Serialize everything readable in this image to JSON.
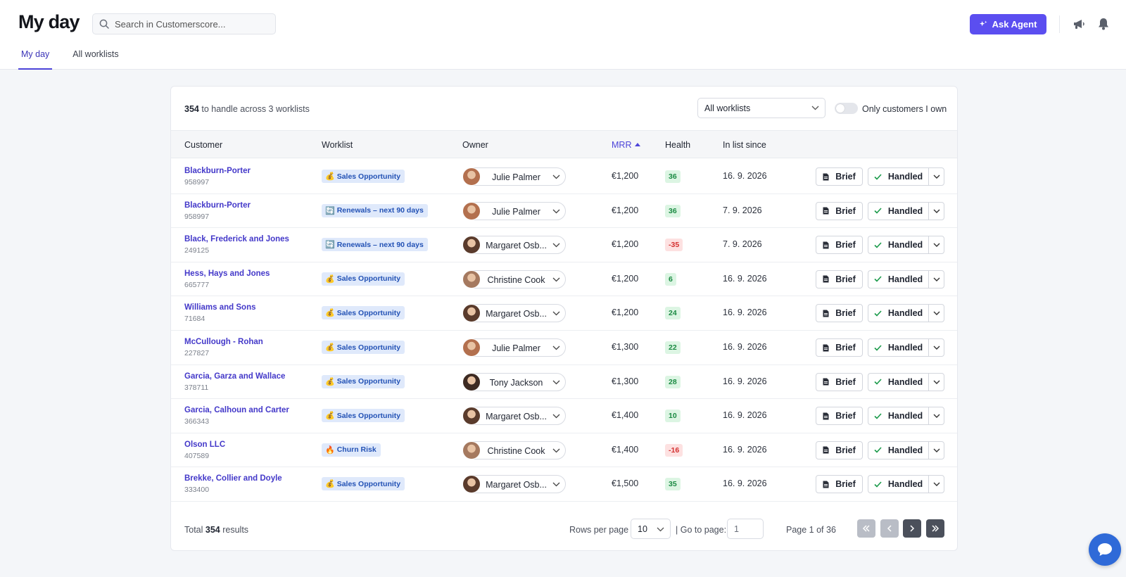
{
  "header": {
    "title": "My day",
    "search_placeholder": "Search in Customerscore...",
    "ask_agent_label": "Ask Agent",
    "tabs": [
      {
        "label": "My day",
        "active": true
      },
      {
        "label": "All worklists",
        "active": false
      }
    ]
  },
  "summary": {
    "count": "354",
    "text": "to handle across 3 worklists"
  },
  "filters": {
    "worklist_select_value": "All worklists",
    "toggle_label": "Only customers I own",
    "toggle_on": false
  },
  "columns": {
    "customer": "Customer",
    "worklist": "Worklist",
    "owner": "Owner",
    "mrr": "MRR",
    "health": "Health",
    "in_list_since": "In list since"
  },
  "actions": {
    "brief_label": "Brief",
    "handled_label": "Handled"
  },
  "rows": [
    {
      "name": "Blackburn-Porter",
      "id": "958997",
      "worklist": "Sales Opportunity",
      "worklist_icon": "money-bag",
      "owner": "Julie Palmer",
      "owner_avatar_color": "#b3704e",
      "mrr": "€1,200",
      "health": "36",
      "health_status": "positive",
      "since": "16. 9. 2026"
    },
    {
      "name": "Blackburn-Porter",
      "id": "958997",
      "worklist": "Renewals – next 90 days",
      "worklist_icon": "renew-arrows",
      "owner": "Julie Palmer",
      "owner_avatar_color": "#b3704e",
      "mrr": "€1,200",
      "health": "36",
      "health_status": "positive",
      "since": "7. 9. 2026"
    },
    {
      "name": "Black, Frederick and Jones",
      "id": "249125",
      "worklist": "Renewals – next 90 days",
      "worklist_icon": "renew-arrows",
      "owner": "Margaret Osb...",
      "owner_avatar_color": "#5a3b2c",
      "mrr": "€1,200",
      "health": "-35",
      "health_status": "negative",
      "since": "7. 9. 2026"
    },
    {
      "name": "Hess, Hays and Jones",
      "id": "665777",
      "worklist": "Sales Opportunity",
      "worklist_icon": "money-bag",
      "owner": "Christine Cook",
      "owner_avatar_color": "#a5795f",
      "mrr": "€1,200",
      "health": "6",
      "health_status": "positive",
      "since": "16. 9. 2026"
    },
    {
      "name": "Williams and Sons",
      "id": "71684",
      "worklist": "Sales Opportunity",
      "worklist_icon": "money-bag",
      "owner": "Margaret Osb...",
      "owner_avatar_color": "#5a3b2c",
      "mrr": "€1,200",
      "health": "24",
      "health_status": "positive",
      "since": "16. 9. 2026"
    },
    {
      "name": "McCullough - Rohan",
      "id": "227827",
      "worklist": "Sales Opportunity",
      "worklist_icon": "money-bag",
      "owner": "Julie Palmer",
      "owner_avatar_color": "#b3704e",
      "mrr": "€1,300",
      "health": "22",
      "health_status": "positive",
      "since": "16. 9. 2026"
    },
    {
      "name": "Garcia, Garza and Wallace",
      "id": "378711",
      "worklist": "Sales Opportunity",
      "worklist_icon": "money-bag",
      "owner": "Tony Jackson",
      "owner_avatar_color": "#3d2a22",
      "mrr": "€1,300",
      "health": "28",
      "health_status": "positive",
      "since": "16. 9. 2026"
    },
    {
      "name": "Garcia, Calhoun and Carter",
      "id": "366343",
      "worklist": "Sales Opportunity",
      "worklist_icon": "money-bag",
      "owner": "Margaret Osb...",
      "owner_avatar_color": "#5a3b2c",
      "mrr": "€1,400",
      "health": "10",
      "health_status": "positive",
      "since": "16. 9. 2026"
    },
    {
      "name": "Olson LLC",
      "id": "407589",
      "worklist": "Churn Risk",
      "worklist_icon": "fire",
      "owner": "Christine Cook",
      "owner_avatar_color": "#a5795f",
      "mrr": "€1,400",
      "health": "-16",
      "health_status": "negative",
      "since": "16. 9. 2026"
    },
    {
      "name": "Brekke, Collier and Doyle",
      "id": "333400",
      "worklist": "Sales Opportunity",
      "worklist_icon": "money-bag",
      "owner": "Margaret Osb...",
      "owner_avatar_color": "#5a3b2c",
      "mrr": "€1,500",
      "health": "35",
      "health_status": "positive",
      "since": "16. 9. 2026"
    }
  ],
  "footer": {
    "total_prefix": "Total",
    "total_count": "354",
    "total_suffix": "results",
    "rows_per_page_label": "Rows per page",
    "rows_per_page_value": "10",
    "goto_label": "| Go to page:",
    "goto_value": "1",
    "page_info": "Page 1 of 36"
  },
  "colors": {
    "accent": "#5b4ef0",
    "link": "#4338c9",
    "health_positive_bg": "#dcf5e3",
    "health_negative_bg": "#fde1e1",
    "chat": "#2f6ad8"
  }
}
